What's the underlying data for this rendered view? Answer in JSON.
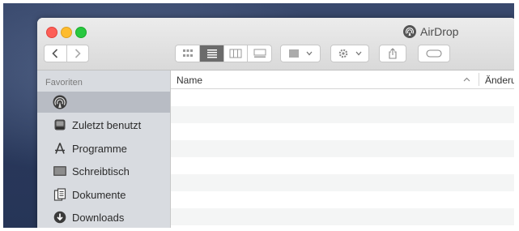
{
  "window": {
    "title": "AirDrop"
  },
  "toolbar": {
    "back_icon": "chevron-left-icon",
    "forward_icon": "chevron-right-icon",
    "views": [
      "icon-view",
      "list-view",
      "column-view",
      "gallery-view"
    ],
    "active_view": "list-view",
    "arrange_icon": "arrange-icon",
    "action_icon": "gear-icon",
    "share_icon": "share-icon",
    "tag_icon": "tag-icon"
  },
  "sidebar": {
    "header": "Favoriten",
    "items": [
      {
        "label": "",
        "icon": "airdrop-icon",
        "selected": true
      },
      {
        "label": "Zuletzt benutzt",
        "icon": "recents-icon"
      },
      {
        "label": "Programme",
        "icon": "applications-icon"
      },
      {
        "label": "Schreibtisch",
        "icon": "desktop-icon"
      },
      {
        "label": "Dokumente",
        "icon": "documents-icon"
      },
      {
        "label": "Downloads",
        "icon": "downloads-icon"
      }
    ]
  },
  "list": {
    "columns": [
      "Name",
      "Änderu"
    ],
    "sorted_column": "Name",
    "sort_direction": "ascending"
  },
  "colors": {
    "close": "#fd5f57",
    "minimize": "#febc2e",
    "maximize": "#28c840",
    "sidebar_bg": "#d8dbe0",
    "selected_row": "#b8bcc4"
  }
}
